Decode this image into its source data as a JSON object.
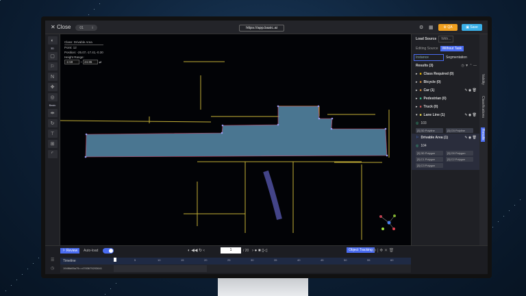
{
  "header": {
    "close_label": "Close",
    "frame_id": "01",
    "info_icon": "i",
    "url": "https://app.basic.ai",
    "qa_label": "QA",
    "save_label": "Save"
  },
  "left_toolbar": {
    "mode_label": "3D",
    "basic_label": "Basic"
  },
  "info_overlay": {
    "class_line": "Class:  Drivable Area",
    "points_line": "Point:  12",
    "position_line": "Position:  -25.07,-17.41,-0.30",
    "height_label": "Height Range:",
    "height_min": "-2.59",
    "height_max": "24.86"
  },
  "right_panel": {
    "load_source_label": "Load Source",
    "load_source_value": "With...",
    "editing_source_label": "Editing Source",
    "editing_source_value": "Without Task",
    "tabs": [
      "Instance",
      "Segmentation"
    ],
    "results_label": "Results (3)",
    "classes": [
      {
        "label": "Class Required  (0)",
        "color": "#e8b400"
      },
      {
        "label": "Bicycle  (0)",
        "color": "#c8863a"
      },
      {
        "label": "Car  (1)",
        "color": "#c8863a"
      },
      {
        "label": "Pedestrian  (0)",
        "color": "#3bbf8a"
      },
      {
        "label": "Truck  (0)",
        "color": "#d05a5a"
      },
      {
        "label": "Lane Line  (1)",
        "color": "#e8d44a"
      }
    ],
    "lane_object": {
      "id": "103",
      "items": [
        "[3] 3D Polyline",
        "[3] O3 Polyline"
      ]
    },
    "drivable": {
      "label": "Drivable Area  (1)",
      "id": "104",
      "items": [
        "[3] 3D Polygon",
        "[3] O0 Polygon",
        "[3] C1 Polygon",
        "[3] C2 Polygon",
        "[3] C3 Polygon"
      ]
    },
    "vertical_tabs": [
      "Validity",
      "Classifications",
      "Results"
    ]
  },
  "bottom": {
    "review_label": "Review",
    "autoload_label": "Auto-load",
    "autoload_on": true,
    "frame_current": "1",
    "frame_total": "/ 20",
    "object_tracking_label": "Object Tracking",
    "timeline_label": "Timeline",
    "timeline_ticks": [
      "5",
      "10",
      "15",
      "20",
      "25",
      "30",
      "35",
      "40",
      "45",
      "50",
      "55",
      "60"
    ],
    "track_label": "194f8d65a75==4783675203641"
  },
  "colors": {
    "accent": "#4a6cf0",
    "qa": "#f0a020",
    "save": "#3ab0e8",
    "polygon_fill": "#5f97b8",
    "points": "#e8d040"
  }
}
